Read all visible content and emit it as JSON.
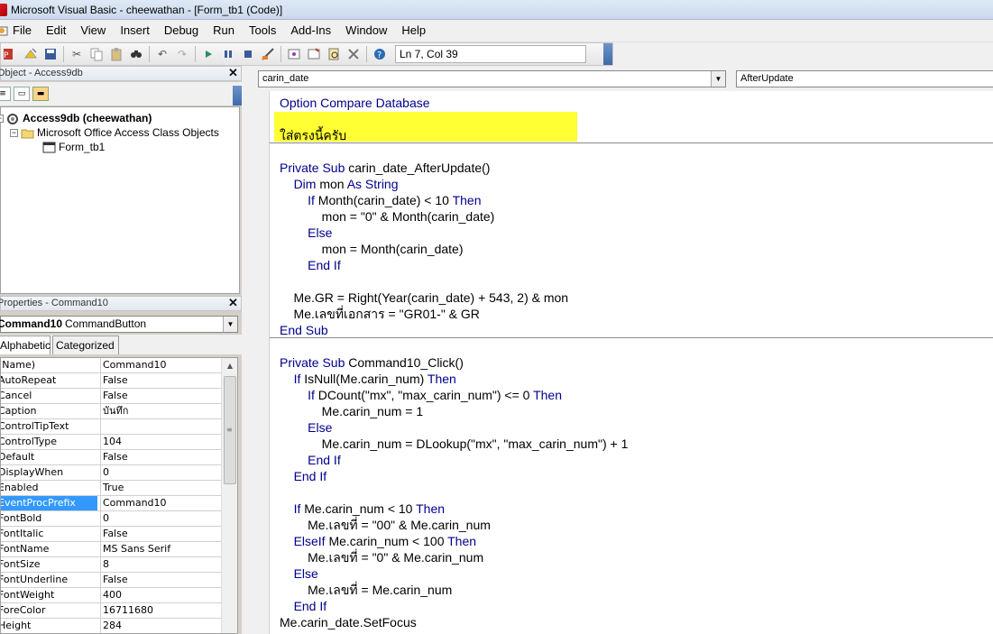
{
  "window": {
    "title": "Microsoft Visual Basic - cheewathan - [Form_tb1 (Code)]"
  },
  "menu": [
    "File",
    "Edit",
    "View",
    "Insert",
    "Debug",
    "Run",
    "Tools",
    "Add-Ins",
    "Window",
    "Help"
  ],
  "toolbar": {
    "position": "Ln 7, Col 39",
    "icons": [
      "access-icon",
      "insert-icon",
      "save-icon",
      "cut-icon",
      "copy-icon",
      "paste-icon",
      "find-icon",
      "undo-icon",
      "redo-icon",
      "run-icon",
      "break-icon",
      "reset-icon",
      "design-mode-icon",
      "project-explorer-icon",
      "properties-icon",
      "object-browser-icon",
      "toolbox-icon",
      "help-icon"
    ]
  },
  "project_pane": {
    "title": "Object - Access9db",
    "root": "Access9db (cheewathan)",
    "folder": "Microsoft Office Access Class Objects",
    "item": "Form_tb1"
  },
  "properties_pane": {
    "title": "Properties - Command10",
    "object_name": "Command10",
    "object_type": "CommandButton",
    "tabs": [
      "Alphabetic",
      "Categorized"
    ],
    "rows": [
      {
        "name": "(Name)",
        "value": "Command10"
      },
      {
        "name": "AutoRepeat",
        "value": "False"
      },
      {
        "name": "Cancel",
        "value": "False"
      },
      {
        "name": "Caption",
        "value": "บันทึก"
      },
      {
        "name": "ControlTipText",
        "value": ""
      },
      {
        "name": "ControlType",
        "value": "104"
      },
      {
        "name": "Default",
        "value": "False"
      },
      {
        "name": "DisplayWhen",
        "value": "0"
      },
      {
        "name": "Enabled",
        "value": "True"
      },
      {
        "name": "EventProcPrefix",
        "value": "Command10"
      },
      {
        "name": "FontBold",
        "value": "0"
      },
      {
        "name": "FontItalic",
        "value": "False"
      },
      {
        "name": "FontName",
        "value": "MS Sans Serif"
      },
      {
        "name": "FontSize",
        "value": "8"
      },
      {
        "name": "FontUnderline",
        "value": "False"
      },
      {
        "name": "FontWeight",
        "value": "400"
      },
      {
        "name": "ForeColor",
        "value": "16711680"
      },
      {
        "name": "Height",
        "value": "284"
      }
    ],
    "selected_row": "EventProcPrefix"
  },
  "code_window": {
    "object_combo": "carin_date",
    "proc_combo": "AfterUpdate",
    "highlight_text": "ใส่ตรงนี้ครับ"
  },
  "code_lines": [
    [
      {
        "k": 1,
        "t": "Option Compare Database"
      }
    ],
    [],
    [
      {
        "k": 0,
        "t": "ใส่ตรงนี้ครับ"
      }
    ],
    [],
    [
      {
        "k": 1,
        "t": "Private Sub "
      },
      {
        "k": 0,
        "t": "carin_date_AfterUpdate()"
      }
    ],
    [
      {
        "k": 0,
        "t": "    "
      },
      {
        "k": 1,
        "t": "Dim "
      },
      {
        "k": 0,
        "t": "mon "
      },
      {
        "k": 1,
        "t": "As String"
      }
    ],
    [
      {
        "k": 0,
        "t": "        "
      },
      {
        "k": 1,
        "t": "If "
      },
      {
        "k": 0,
        "t": "Month(carin_date) < 10 "
      },
      {
        "k": 1,
        "t": "Then"
      }
    ],
    [
      {
        "k": 0,
        "t": "            mon = \"0\" & Month(carin_date)"
      }
    ],
    [
      {
        "k": 0,
        "t": "        "
      },
      {
        "k": 1,
        "t": "Else"
      }
    ],
    [
      {
        "k": 0,
        "t": "            mon = Month(carin_date)"
      }
    ],
    [
      {
        "k": 0,
        "t": "        "
      },
      {
        "k": 1,
        "t": "End If"
      }
    ],
    [],
    [
      {
        "k": 0,
        "t": "    Me.GR = Right(Year(carin_date) + 543, 2) & mon"
      }
    ],
    [
      {
        "k": 0,
        "t": "    Me.เลขที่เอกสาร = \"GR01-\" & GR"
      }
    ],
    [
      {
        "k": 1,
        "t": "End Sub"
      }
    ],
    [],
    [
      {
        "k": 1,
        "t": "Private Sub "
      },
      {
        "k": 0,
        "t": "Command10_Click()"
      }
    ],
    [
      {
        "k": 0,
        "t": "    "
      },
      {
        "k": 1,
        "t": "If "
      },
      {
        "k": 0,
        "t": "IsNull(Me.carin_num) "
      },
      {
        "k": 1,
        "t": "Then"
      }
    ],
    [
      {
        "k": 0,
        "t": "        "
      },
      {
        "k": 1,
        "t": "If "
      },
      {
        "k": 0,
        "t": "DCount(\"mx\", \"max_carin_num\") <= 0 "
      },
      {
        "k": 1,
        "t": "Then"
      }
    ],
    [
      {
        "k": 0,
        "t": "            Me.carin_num = 1"
      }
    ],
    [
      {
        "k": 0,
        "t": "        "
      },
      {
        "k": 1,
        "t": "Else"
      }
    ],
    [
      {
        "k": 0,
        "t": "            Me.carin_num = DLookup(\"mx\", \"max_carin_num\") + 1"
      }
    ],
    [
      {
        "k": 0,
        "t": "        "
      },
      {
        "k": 1,
        "t": "End If"
      }
    ],
    [
      {
        "k": 0,
        "t": "    "
      },
      {
        "k": 1,
        "t": "End If"
      }
    ],
    [],
    [
      {
        "k": 0,
        "t": "    "
      },
      {
        "k": 1,
        "t": "If "
      },
      {
        "k": 0,
        "t": "Me.carin_num < 10 "
      },
      {
        "k": 1,
        "t": "Then"
      }
    ],
    [
      {
        "k": 0,
        "t": "        Me.เลขที่ = \"00\" & Me.carin_num"
      }
    ],
    [
      {
        "k": 0,
        "t": "    "
      },
      {
        "k": 1,
        "t": "ElseIf "
      },
      {
        "k": 0,
        "t": "Me.carin_num < 100 "
      },
      {
        "k": 1,
        "t": "Then"
      }
    ],
    [
      {
        "k": 0,
        "t": "        Me.เลขที่ = \"0\" & Me.carin_num"
      }
    ],
    [
      {
        "k": 0,
        "t": "    "
      },
      {
        "k": 1,
        "t": "Else"
      }
    ],
    [
      {
        "k": 0,
        "t": "        Me.เลขที่ = Me.carin_num"
      }
    ],
    [
      {
        "k": 0,
        "t": "    "
      },
      {
        "k": 1,
        "t": "End If"
      }
    ],
    [
      {
        "k": 0,
        "t": "Me.carin_date.SetFocus"
      }
    ]
  ],
  "colors": {
    "keyword": "#00008b",
    "highlight": "#ffff33",
    "selection": "#3399ff"
  }
}
